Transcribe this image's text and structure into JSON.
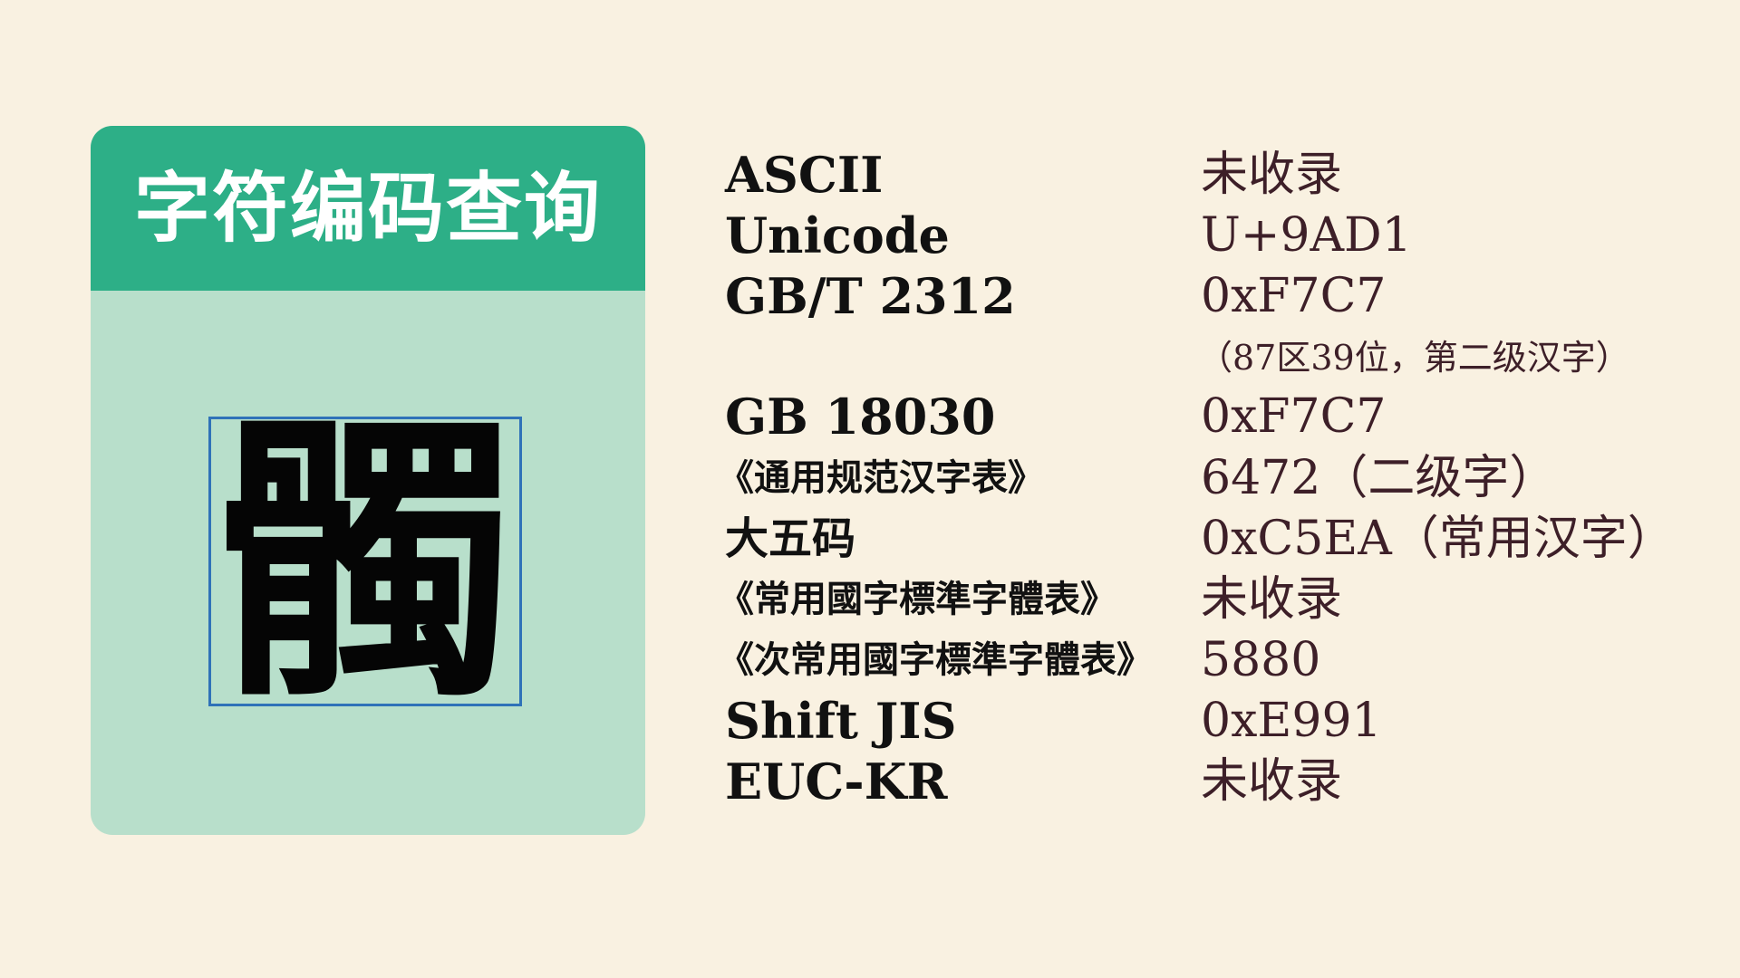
{
  "card": {
    "title": "字符编码查询",
    "character": "髑"
  },
  "encodings": [
    {
      "label": "ASCII",
      "value": "未收录"
    },
    {
      "label": "Unicode",
      "value": "U+9AD1"
    },
    {
      "label": "GB/T 2312",
      "value": "0xF7C7"
    },
    {
      "label": "",
      "value": "（87区39位，第二级汉字）"
    },
    {
      "label": "GB 18030",
      "value": "0xF7C7"
    },
    {
      "label": "《通用规范汉字表》",
      "value": "6472（二级字）"
    },
    {
      "label": "大五码",
      "value": "0xC5EA（常用汉字）"
    },
    {
      "label": "《常用國字標準字體表》",
      "value": "未收录"
    },
    {
      "label": "《次常用國字標準字體表》",
      "value": "5880"
    },
    {
      "label": "Shift JIS",
      "value": "0xE991"
    },
    {
      "label": "EUC-KR",
      "value": "未收录"
    }
  ]
}
